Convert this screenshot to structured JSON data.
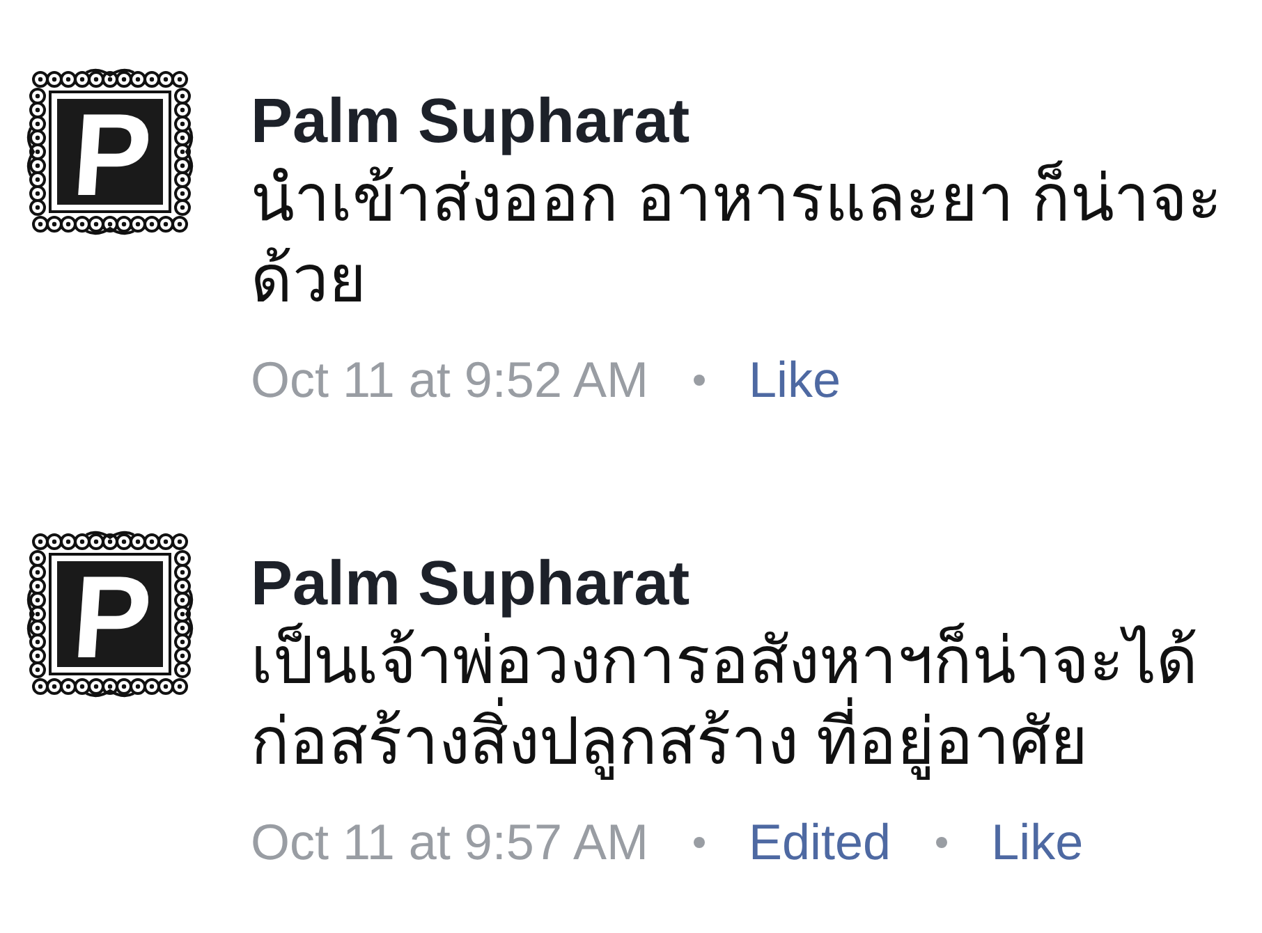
{
  "comments": [
    {
      "avatar": {
        "letter": "P"
      },
      "author": "Palm Supharat",
      "text": "นำเข้าส่งออก อาหารและยา ก็น่าจะด้วย",
      "meta": [
        {
          "kind": "time",
          "label": "Oct 11 at 9:52 AM"
        },
        {
          "kind": "link",
          "label": "Like"
        }
      ]
    },
    {
      "avatar": {
        "letter": "P"
      },
      "author": "Palm Supharat",
      "text": "เป็นเจ้าพ่อวงการอสังหาฯก็น่าจะได้ก่อสร้างสิ่งปลูกสร้าง ที่อยู่อาศัย",
      "meta": [
        {
          "kind": "time",
          "label": "Oct 11 at 9:57 AM"
        },
        {
          "kind": "link",
          "label": "Edited"
        },
        {
          "kind": "link",
          "label": "Like"
        }
      ]
    }
  ]
}
